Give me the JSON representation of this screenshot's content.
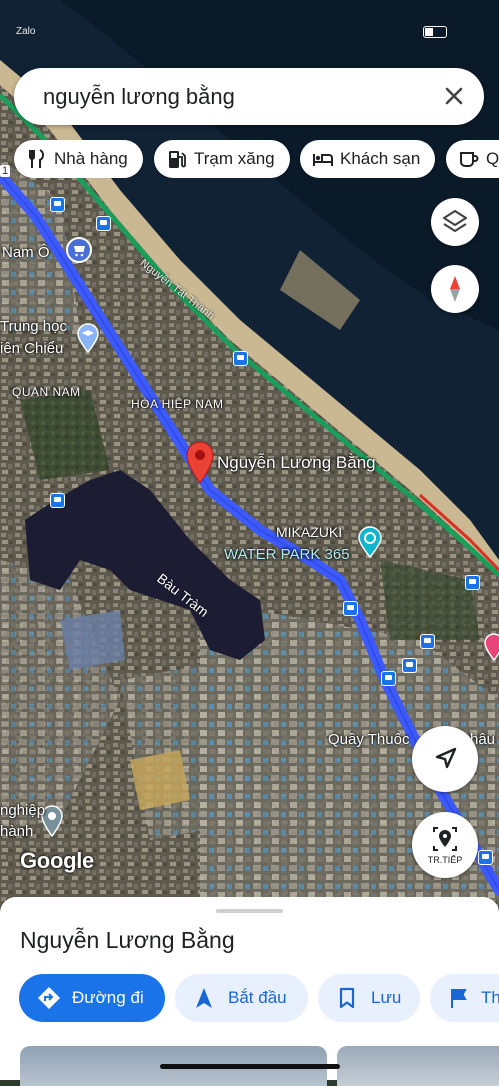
{
  "status_bar": {
    "left_text": "Zalo"
  },
  "search": {
    "query": "nguyễn lương bằng"
  },
  "chips": [
    {
      "label": "Nhà hàng",
      "icon": "restaurant-icon"
    },
    {
      "label": "Trạm xăng",
      "icon": "gas-station-icon"
    },
    {
      "label": "Khách sạn",
      "icon": "hotel-icon"
    },
    {
      "label": "Q",
      "icon": "coffee-icon"
    }
  ],
  "map": {
    "labels": {
      "nam_o": "Nam Ô",
      "truong_hoc": "Trung học",
      "lien_chieu": "iên Chiểu",
      "quan_nam": "QUAN NAM",
      "hoa_hiep_nam": "HÒA HIỆP NAM",
      "nguyen_tat_thanh": "Nguyễn Tất Thành",
      "mikazuki_1": "MIKAZUKI",
      "mikazuki_2": "WATER PARK 365",
      "bau_tram": "Bàu Tràm",
      "quay_thuoc": "Quầy Thuốc",
      "quay_thuoc_tail": "hâu",
      "nghiep_1": "nghiệp",
      "nghiep_2": "hành",
      "road_number": "1",
      "pin_label": "Nguyễn Lương Bằng"
    },
    "logo": "Google",
    "colors": {
      "route": "#3d5afe",
      "pin": "#ea4335",
      "highway": "#1a9e5a",
      "water": "#0d1c2b"
    }
  },
  "buttons": {
    "layers": "layers-icon",
    "compass": "compass-icon",
    "my_location": "navigation-arrow-icon",
    "tr_tiep": "TR.TIẾP"
  },
  "sheet": {
    "title": "Nguyễn Lương Bằng",
    "actions": [
      {
        "label": "Đường đi",
        "icon": "directions-icon"
      },
      {
        "label": "Bắt đầu",
        "icon": "navigation-icon"
      },
      {
        "label": "Lưu",
        "icon": "bookmark-icon"
      },
      {
        "label": "Th",
        "icon": "flag-icon"
      }
    ]
  }
}
